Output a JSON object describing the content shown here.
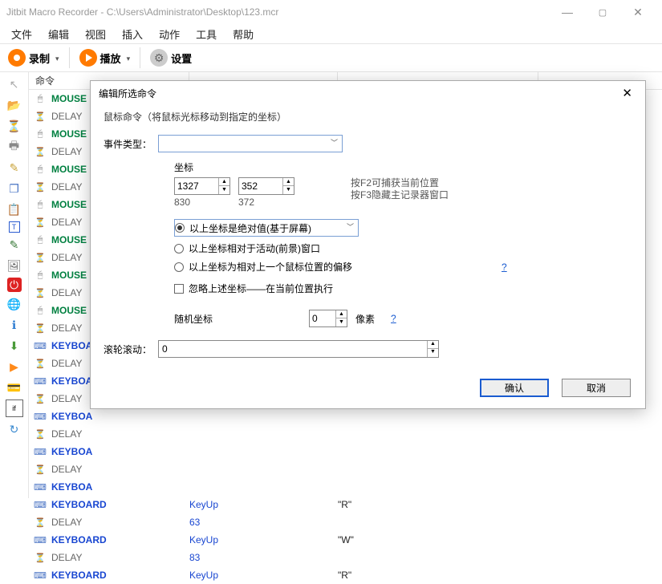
{
  "window": {
    "title": "Jitbit Macro Recorder - C:\\Users\\Administrator\\Desktop\\123.mcr"
  },
  "menu": {
    "file": "文件",
    "edit": "编辑",
    "view": "视图",
    "insert": "插入",
    "action": "动作",
    "tools": "工具",
    "help": "帮助"
  },
  "toolbar": {
    "record": "录制",
    "play": "播放",
    "settings": "设置"
  },
  "list": {
    "header": "命令",
    "rows": [
      {
        "t": "mouse",
        "c1": "MOUSE"
      },
      {
        "t": "delay",
        "c1": "DELAY"
      },
      {
        "t": "mouse",
        "c1": "MOUSE"
      },
      {
        "t": "delay",
        "c1": "DELAY"
      },
      {
        "t": "mouse",
        "c1": "MOUSE"
      },
      {
        "t": "delay",
        "c1": "DELAY"
      },
      {
        "t": "mouse",
        "c1": "MOUSE"
      },
      {
        "t": "delay",
        "c1": "DELAY"
      },
      {
        "t": "mouse",
        "c1": "MOUSE"
      },
      {
        "t": "delay",
        "c1": "DELAY"
      },
      {
        "t": "mouse",
        "c1": "MOUSE"
      },
      {
        "t": "delay",
        "c1": "DELAY"
      },
      {
        "t": "mouse",
        "c1": "MOUSE"
      },
      {
        "t": "delay",
        "c1": "DELAY"
      },
      {
        "t": "keybd",
        "c1": "KEYBOA"
      },
      {
        "t": "delay",
        "c1": "DELAY"
      },
      {
        "t": "keybd",
        "c1": "KEYBOA"
      },
      {
        "t": "delay",
        "c1": "DELAY"
      },
      {
        "t": "keybd",
        "c1": "KEYBOA"
      },
      {
        "t": "delay",
        "c1": "DELAY"
      },
      {
        "t": "keybd",
        "c1": "KEYBOA"
      },
      {
        "t": "delay",
        "c1": "DELAY"
      },
      {
        "t": "keybd",
        "c1": "KEYBOA"
      },
      {
        "t": "keybd",
        "c1": "KEYBOARD",
        "c2": "KeyUp",
        "c3": "\"R\""
      },
      {
        "t": "delay",
        "c1": "DELAY",
        "c2": "63"
      },
      {
        "t": "keybd",
        "c1": "KEYBOARD",
        "c2": "KeyUp",
        "c3": "\"W\""
      },
      {
        "t": "delay",
        "c1": "DELAY",
        "c2": "83"
      },
      {
        "t": "keybd",
        "c1": "KEYBOARD",
        "c2": "KeyUp",
        "c3": "\"R\""
      }
    ]
  },
  "dialog": {
    "title": "编辑所选命令",
    "desc": "鼠标命令（将鼠标光标移动到指定的坐标）",
    "evtype_lbl": "事件类型：",
    "coord_lbl": "坐标",
    "x": "1327",
    "y": "352",
    "x_sub": "830",
    "y_sub": "372",
    "hint1": "按F2可捕获当前位置",
    "hint2": "按F3隐藏主记录器窗口",
    "r1": "以上坐标是绝对值(基于屏幕)",
    "r2": "以上坐标相对于活动(前景)窗口",
    "r3": "以上坐标为相对上一个鼠标位置的偏移",
    "chk1": "忽略上述坐标——在当前位置执行",
    "rand_lbl": "随机坐标",
    "rand_val": "0",
    "rand_unit": "像素",
    "scroll_lbl": "滚轮滚动：",
    "scroll_val": "0",
    "ok": "确认",
    "cancel": "取消",
    "q": "?"
  },
  "icons": {
    "mouseI": "🖱",
    "delayI": "⏳",
    "keyI": "⌨"
  }
}
